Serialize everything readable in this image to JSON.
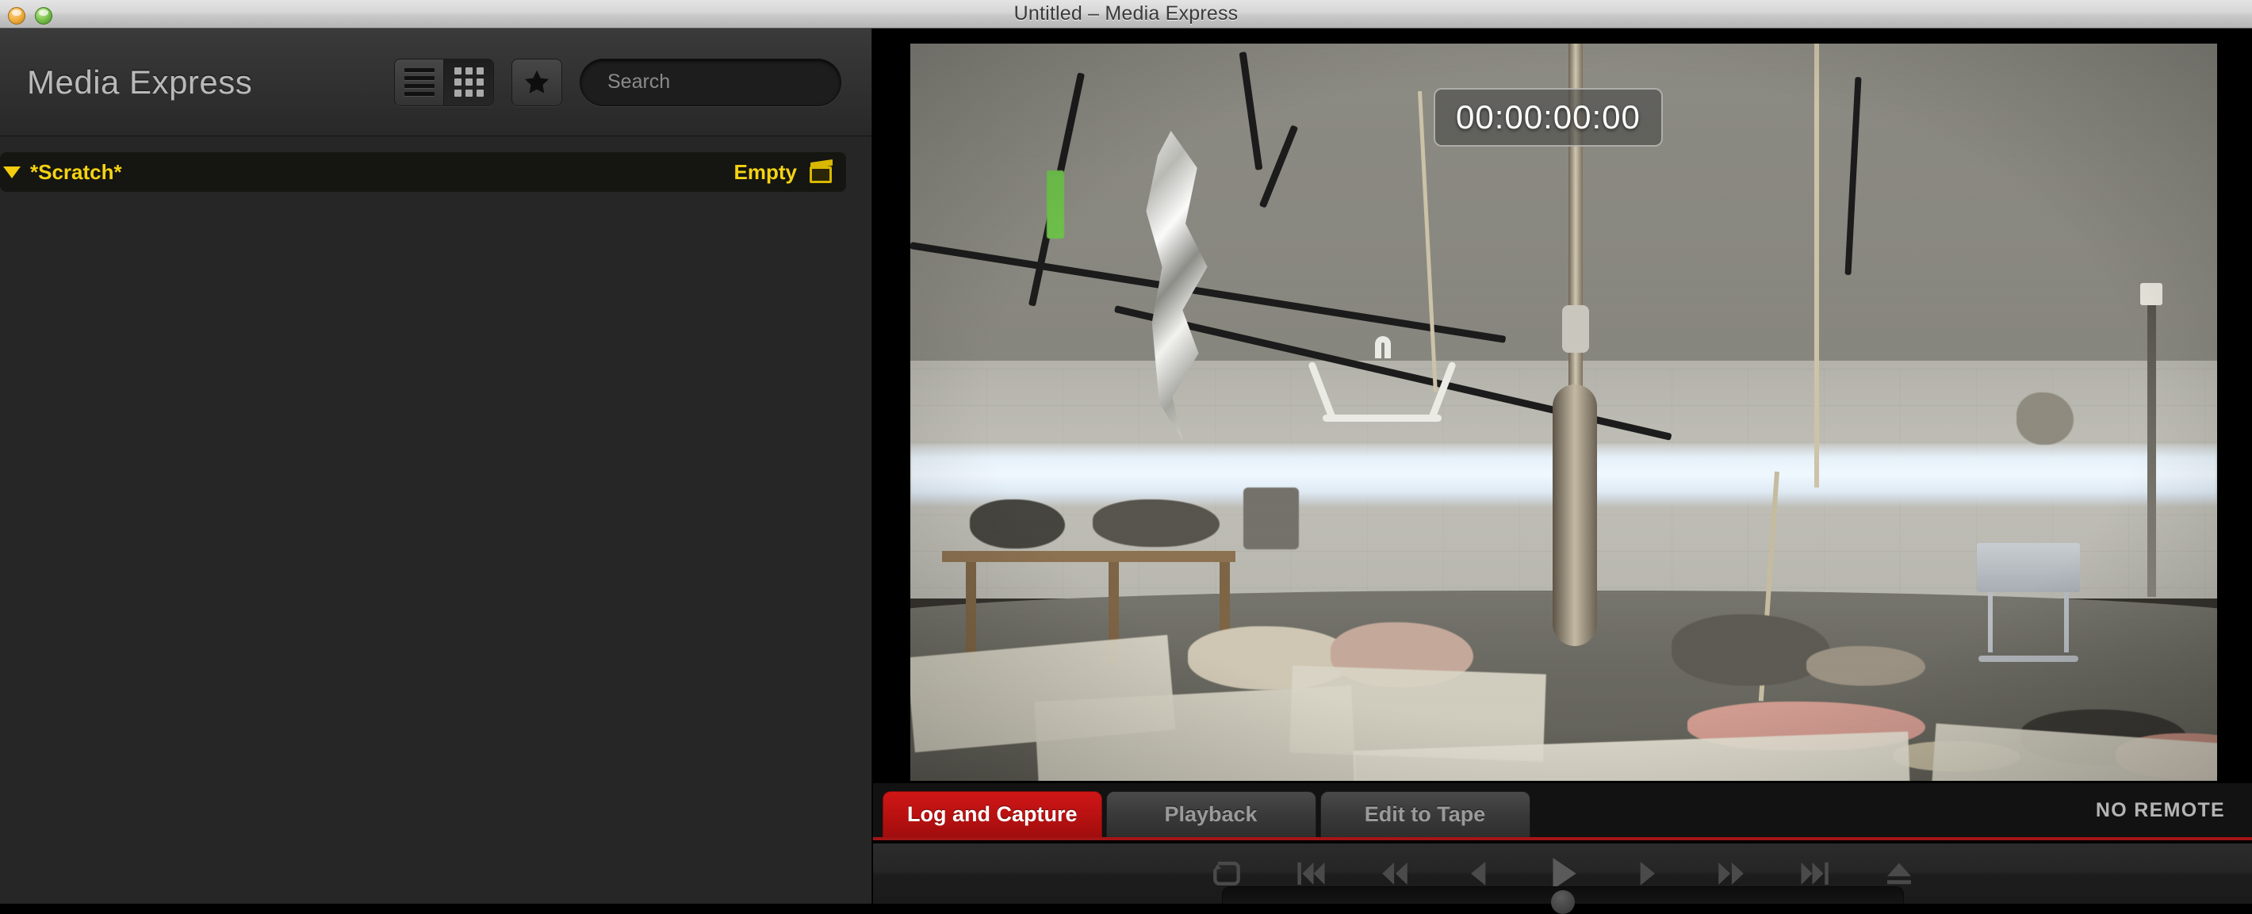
{
  "window": {
    "title": "Untitled – Media Express",
    "traffic_lights": [
      "minimize-amber",
      "zoom-green"
    ]
  },
  "sidebar": {
    "app_name": "Media Express",
    "view_buttons": [
      {
        "name": "list-view",
        "icon": "list-icon",
        "active": false
      },
      {
        "name": "grid-view",
        "icon": "grid-icon",
        "active": true
      }
    ],
    "favorites_button": {
      "label": "",
      "icon": "star-icon"
    },
    "search": {
      "placeholder": "Search",
      "value": "",
      "icon": "search-icon"
    },
    "bins": [
      {
        "name": "*Scratch*",
        "status": "Empty",
        "icon": "clapperboard-icon",
        "expanded": true,
        "accent_color": "#f5d312"
      }
    ]
  },
  "viewer": {
    "timecode": "00:00:00:00",
    "scene_description": "Studio interior with hanging foil sculpture, coat hanger, ropes and debris on concrete floor"
  },
  "tabs": [
    {
      "label": "Log and Capture",
      "active": true
    },
    {
      "label": "Playback",
      "active": false
    },
    {
      "label": "Edit to Tape",
      "active": false
    }
  ],
  "status": {
    "remote": "NO REMOTE"
  },
  "transport": {
    "buttons": [
      {
        "name": "loop-button",
        "icon": "loop-icon"
      },
      {
        "name": "skip-to-start-button",
        "icon": "skip-back-icon"
      },
      {
        "name": "rewind-button",
        "icon": "rewind-icon"
      },
      {
        "name": "step-back-button",
        "icon": "step-back-icon"
      },
      {
        "name": "play-button",
        "icon": "play-icon"
      },
      {
        "name": "step-forward-button",
        "icon": "step-forward-icon"
      },
      {
        "name": "fast-forward-button",
        "icon": "fast-forward-icon"
      },
      {
        "name": "skip-to-end-button",
        "icon": "skip-forward-icon"
      },
      {
        "name": "eject-button",
        "icon": "eject-icon"
      }
    ],
    "jog_shuttle": {
      "name": "jog-shuttle",
      "position": 50
    }
  },
  "colors": {
    "accent_red": "#b81111",
    "bin_yellow": "#f5d312",
    "panel_dark": "#262626"
  }
}
